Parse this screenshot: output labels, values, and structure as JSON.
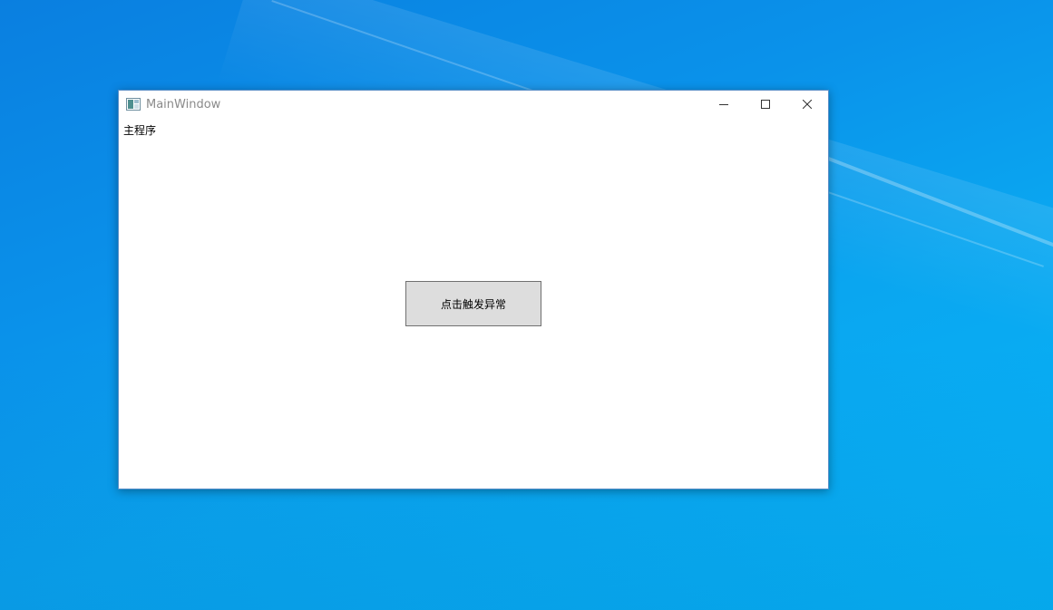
{
  "window": {
    "title": "MainWindow",
    "icon": "window-app-icon"
  },
  "caption": {
    "minimize_icon": "minimize-icon",
    "maximize_icon": "maximize-icon",
    "close_icon": "close-icon"
  },
  "content": {
    "label": "主程序",
    "button_label": "点击触发异常"
  },
  "colors": {
    "desktop_accent": "#0a92ea",
    "title_text": "#8a8a8a",
    "button_bg": "#dddddd",
    "button_border": "#707070"
  }
}
